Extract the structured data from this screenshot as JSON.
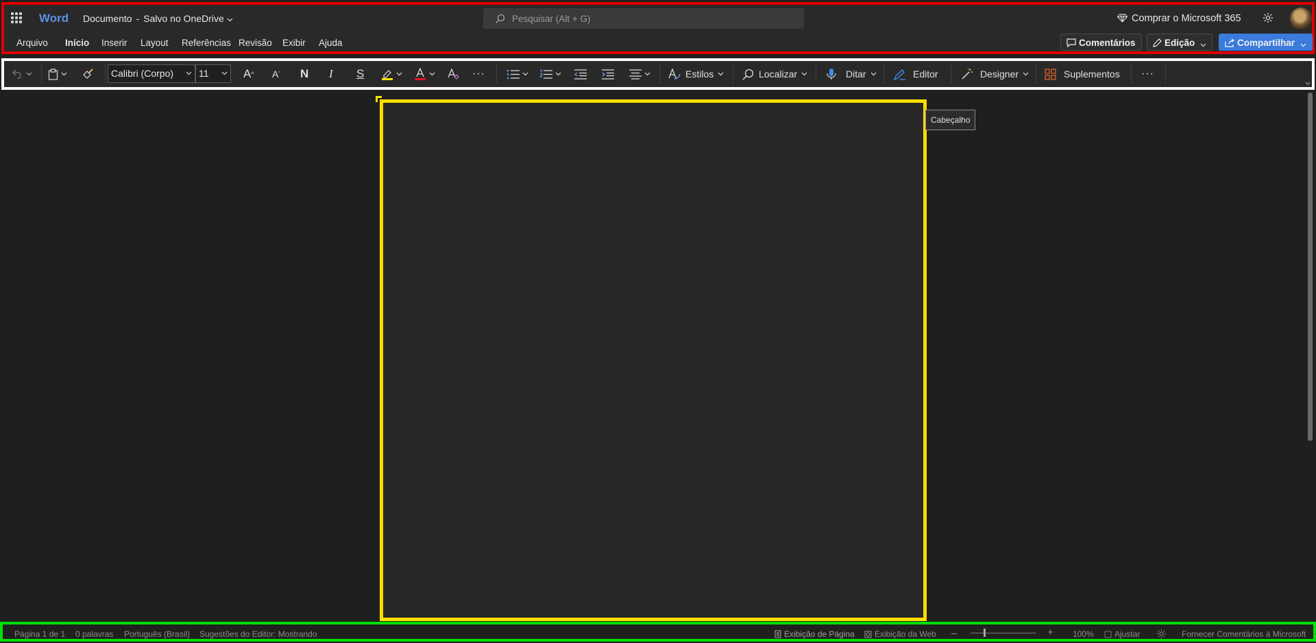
{
  "header": {
    "app_name": "Word",
    "doc_name": "Documento",
    "doc_sep": "-",
    "save_status": "Salvo no OneDrive",
    "search_placeholder": "Pesquisar (Alt + G)",
    "buy_label": "Comprar o Microsoft 365"
  },
  "tabs": [
    {
      "label": "Arquivo"
    },
    {
      "label": "Início",
      "active": true
    },
    {
      "label": "Inserir"
    },
    {
      "label": "Layout"
    },
    {
      "label": "Referências"
    },
    {
      "label": "Revisão"
    },
    {
      "label": "Exibir"
    },
    {
      "label": "Ajuda"
    }
  ],
  "top_buttons": {
    "comments": "Comentários",
    "editing": "Edição",
    "share": "Compartilhar"
  },
  "ribbon": {
    "font_name": "Calibri (Corpo)",
    "font_size": "11",
    "bold_glyph": "N",
    "italic_glyph": "I",
    "strike_glyph": "S",
    "grow_glyph": "A",
    "shrink_glyph": "A",
    "more_glyph": "···",
    "styles": "Estilos",
    "find": "Localizar",
    "dictate": "Ditar",
    "editor": "Editor",
    "designer": "Designer",
    "addins": "Suplementos",
    "overflow_glyph": "···",
    "highlight_color": "#ffe400",
    "font_color": "#e81123"
  },
  "canvas": {
    "tooltip": "Cabeçalho"
  },
  "status": {
    "page": "Página 1 de 1",
    "words": "0 palavras",
    "language": "Português (Brasil)",
    "editor_suggestions": "Sugestões do Editor: Mostrando",
    "page_view": "Exibição de Página",
    "web_view": "Exibição da Web",
    "zoom_out": "–",
    "zoom_in": "+",
    "zoom": "100%",
    "fit": "Ajustar",
    "feedback": "Fornecer Comentários à Microsoft",
    "zoom_level": 0.2
  }
}
